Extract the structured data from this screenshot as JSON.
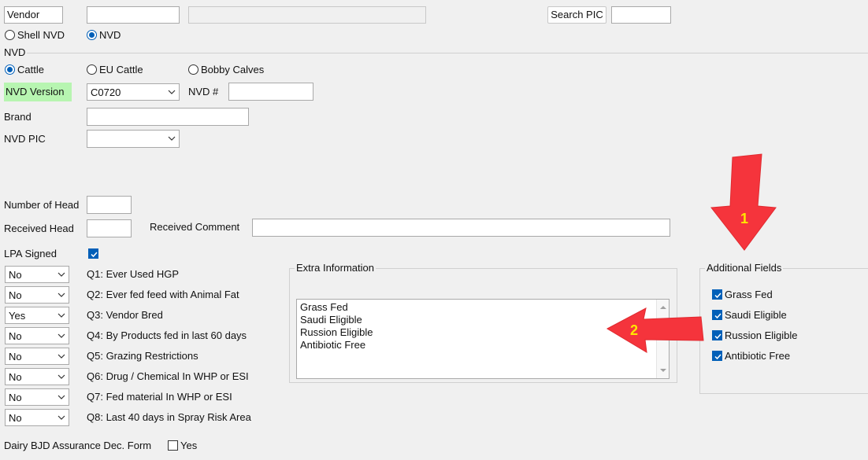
{
  "top": {
    "vendor_value": "Vendor",
    "search_pic_label": "Search PIC"
  },
  "nvd_type": {
    "shell_label": "Shell NVD",
    "nvd_label": "NVD"
  },
  "nvd_section": {
    "heading": "NVD",
    "cattle_label": "Cattle",
    "eu_cattle_label": "EU Cattle",
    "bobby_label": "Bobby Calves",
    "version_label": "NVD Version",
    "version_value": "C0720",
    "nvd_number_label": "NVD #",
    "brand_label": "Brand",
    "nvd_pic_label": "NVD PIC"
  },
  "head": {
    "number_label": "Number of Head",
    "received_label": "Received Head",
    "comment_label": "Received Comment"
  },
  "lpa": {
    "label": "LPA Signed"
  },
  "questions": [
    {
      "value": "No",
      "label": "Q1: Ever Used HGP"
    },
    {
      "value": "No",
      "label": "Q2: Ever fed feed with Animal Fat"
    },
    {
      "value": "Yes",
      "label": "Q3: Vendor Bred"
    },
    {
      "value": "No",
      "label": "Q4: By Products fed in last 60 days"
    },
    {
      "value": "No",
      "label": "Q5: Grazing Restrictions"
    },
    {
      "value": "No",
      "label": "Q6: Drug / Chemical In WHP or ESI"
    },
    {
      "value": "No",
      "label": "Q7: Fed material In WHP or ESI"
    },
    {
      "value": "No",
      "label": "Q8: Last 40 days in Spray Risk Area"
    }
  ],
  "extra": {
    "title": "Extra Information",
    "lines": [
      "Grass Fed",
      "Saudi Eligible",
      "Russion Eligible",
      "Antibiotic Free"
    ]
  },
  "additional": {
    "title": "Additional Fields",
    "items": [
      "Grass Fed",
      "Saudi Eligible",
      "Russion Eligible",
      "Antibiotic Free"
    ]
  },
  "dairy": {
    "label": "Dairy BJD Assurance Dec. Form",
    "yes_label": "Yes"
  },
  "annotations": {
    "arrow1_number": "1",
    "arrow2_number": "2"
  },
  "colors": {
    "accent": "#005fb8",
    "highlight": "#b7f5b1",
    "arrow_red": "#f5343c",
    "arrow_number": "#ffe600"
  }
}
